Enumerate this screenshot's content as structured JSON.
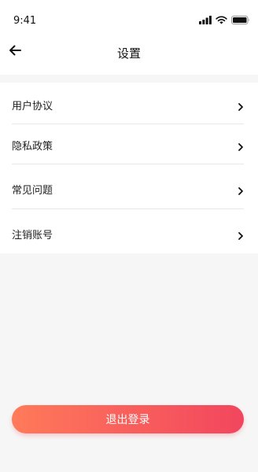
{
  "status_bar": {
    "time": "9:41"
  },
  "nav": {
    "title": "设置"
  },
  "menu": {
    "items": [
      {
        "label": "用户协议"
      },
      {
        "label": "隐私政策"
      },
      {
        "label": "常见问题"
      },
      {
        "label": "注销账号"
      }
    ]
  },
  "logout": {
    "label": "退出登录"
  },
  "colors": {
    "accent_start": "#ff7a5a",
    "accent_end": "#f2465e",
    "background": "#f6f6f6",
    "surface": "#ffffff"
  },
  "icons": {
    "back": "arrow-left-icon",
    "chevron": "chevron-right-icon",
    "signal": "signal-icon",
    "wifi": "wifi-icon",
    "battery": "battery-icon"
  }
}
